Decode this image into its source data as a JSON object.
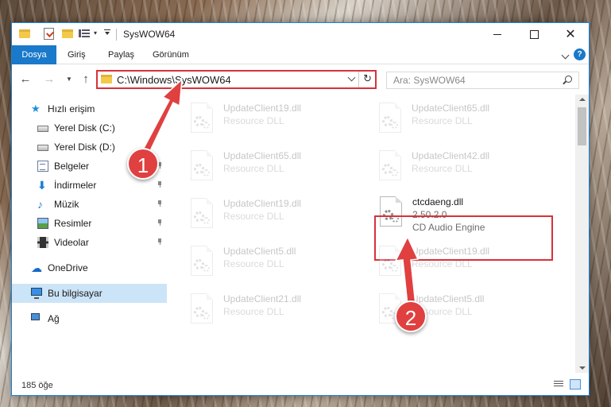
{
  "window": {
    "title": "SysWOW64",
    "controls": {
      "minimize": "–",
      "maximize": "□",
      "close": "✕"
    }
  },
  "ribbon": {
    "tabs": [
      "Dosya",
      "Giriş",
      "Paylaş",
      "Görünüm"
    ],
    "help": "?"
  },
  "address": {
    "path": "C:\\Windows\\SysWOW64",
    "refresh": "↻"
  },
  "search": {
    "placeholder": "Ara: SysWOW64"
  },
  "sidebar": {
    "items": [
      {
        "label": "Hızlı erişim",
        "icon": "star-icon"
      },
      {
        "label": "Yerel Disk (C:)",
        "icon": "drive-icon"
      },
      {
        "label": "Yerel Disk (D:)",
        "icon": "drive-icon"
      },
      {
        "label": "Belgeler",
        "icon": "documents-icon"
      },
      {
        "label": "İndirmeler",
        "icon": "download-icon"
      },
      {
        "label": "Müzik",
        "icon": "music-icon"
      },
      {
        "label": "Resimler",
        "icon": "pictures-icon"
      },
      {
        "label": "Videolar",
        "icon": "videos-icon"
      },
      {
        "label": "OneDrive",
        "icon": "cloud-icon"
      },
      {
        "label": "Bu bilgisayar",
        "icon": "computer-icon"
      },
      {
        "label": "Ağ",
        "icon": "network-icon"
      }
    ]
  },
  "files": [
    {
      "name": "UpdateClient19.dll",
      "desc": "Resource DLL"
    },
    {
      "name": "UpdateClient65.dll",
      "desc": "Resource DLL"
    },
    {
      "name": "UpdateClient65.dll",
      "desc": "Resource DLL"
    },
    {
      "name": "UpdateClient42.dll",
      "desc": "Resource DLL"
    },
    {
      "name": "UpdateClient19.dll",
      "desc": "Resource DLL"
    },
    {
      "name": "ctcdaeng.dll",
      "version": "2.50.2.0",
      "desc": "CD Audio Engine"
    },
    {
      "name": "UpdateClient5.dll",
      "desc": "Resource DLL"
    },
    {
      "name": "UpdateClient19.dll",
      "desc": "Resource DLL"
    },
    {
      "name": "UpdateClient21.dll",
      "desc": "Resource DLL"
    },
    {
      "name": "UpdateClient5.dll",
      "desc": "Resource DLL"
    }
  ],
  "status": {
    "count": "185 öğe"
  },
  "annotations": {
    "step1": "1",
    "step2": "2",
    "color": "#e04040"
  }
}
